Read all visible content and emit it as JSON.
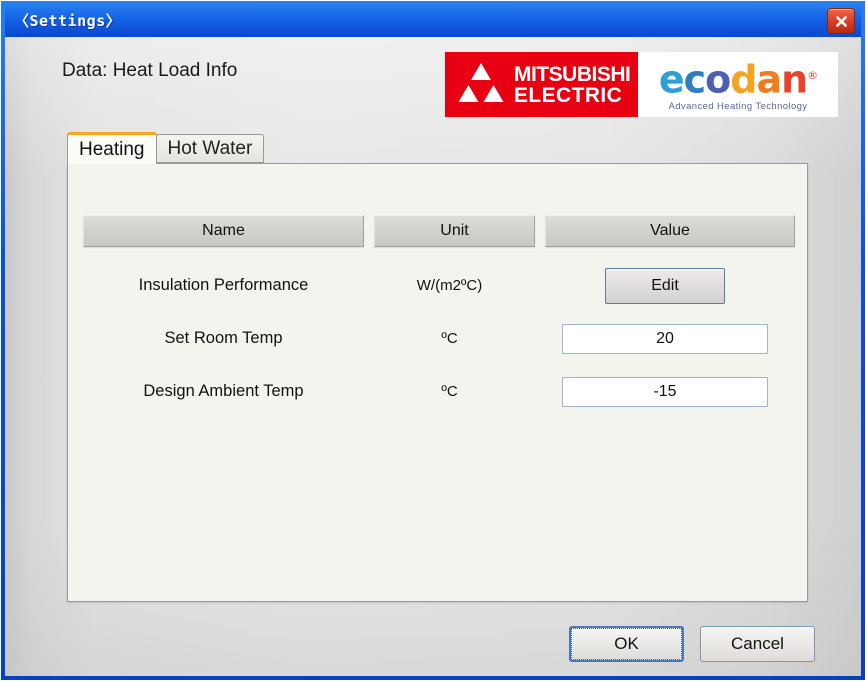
{
  "window": {
    "title": "〈Settings〉",
    "close_icon": "close-icon"
  },
  "header": {
    "data_label": "Data:  Heat Load Info"
  },
  "branding": {
    "mitsubishi": {
      "line1": "MITSUBISHI",
      "line2": "ELECTRIC",
      "brand_color": "#e60012"
    },
    "ecodan": {
      "letters": [
        "e",
        "c",
        "o",
        "d",
        "a",
        "n"
      ],
      "registered_mark": "®",
      "tagline": "Advanced Heating Technology",
      "tagline_color": "#5a6a9a"
    }
  },
  "tabs": [
    {
      "label": "Heating",
      "active": true
    },
    {
      "label": "Hot Water",
      "active": false
    }
  ],
  "table": {
    "columns": [
      "Name",
      "Unit",
      "Value"
    ],
    "rows": [
      {
        "name": "Insulation Performance",
        "unit": "W/(m2ºC)",
        "value_type": "button",
        "value": "Edit"
      },
      {
        "name": "Set Room Temp",
        "unit": "ºC",
        "value_type": "input",
        "value": "20"
      },
      {
        "name": "Design Ambient Temp",
        "unit": "ºC",
        "value_type": "input",
        "value": "-15"
      }
    ]
  },
  "footer": {
    "ok_label": "OK",
    "cancel_label": "Cancel"
  },
  "colors": {
    "title_bar": "#0a47cd",
    "accent_tab": "#f5a623",
    "close_button": "#d93b1e",
    "panel_bg": "#f4f4ef"
  }
}
